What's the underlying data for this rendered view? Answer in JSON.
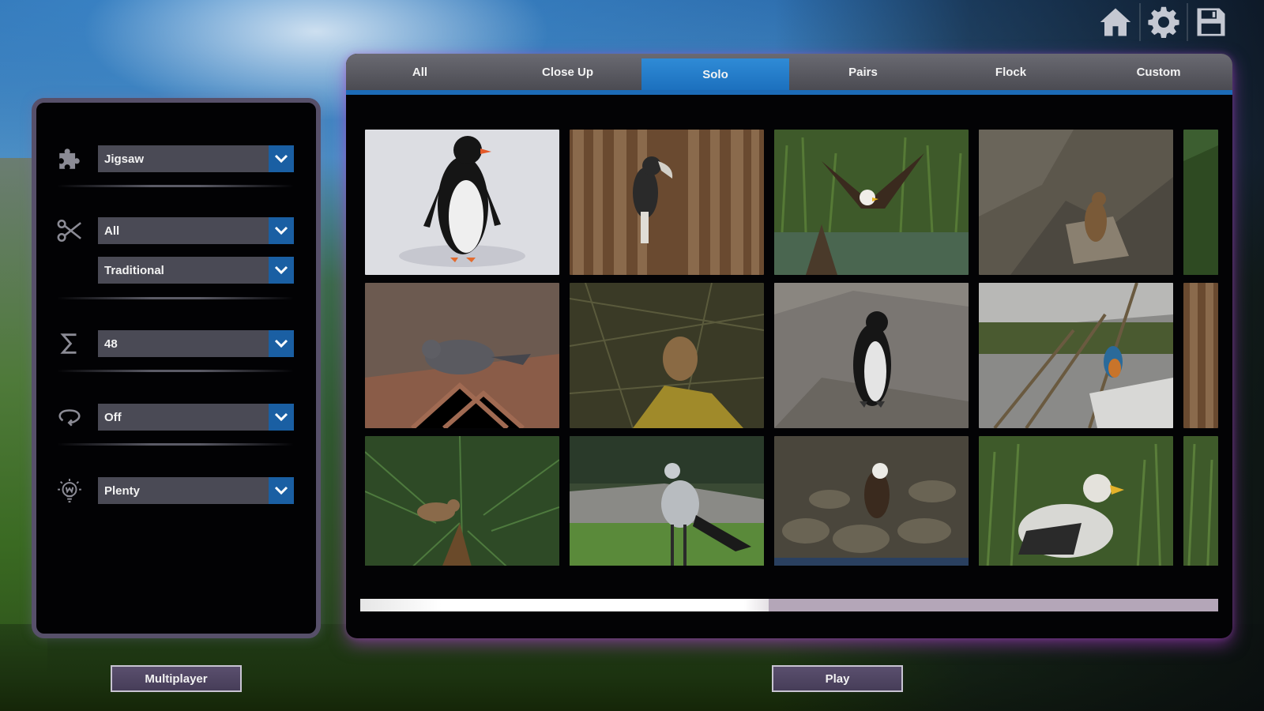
{
  "top_icons": [
    "home-icon",
    "gear-icon",
    "save-icon"
  ],
  "left_panel": {
    "rows": [
      {
        "icon": "puzzle-piece-icon",
        "value": "Jigsaw"
      },
      {
        "icon": "scissors-icon",
        "value": "All"
      },
      {
        "icon": null,
        "value": "Traditional"
      },
      {
        "icon": "sigma-icon",
        "value": "48"
      },
      {
        "icon": "rotate-icon",
        "value": "Off"
      },
      {
        "icon": "lightbulb-icon",
        "value": "Plenty"
      }
    ]
  },
  "tabs": [
    {
      "label": "All",
      "active": false
    },
    {
      "label": "Close Up",
      "active": false
    },
    {
      "label": "Solo",
      "active": true
    },
    {
      "label": "Pairs",
      "active": false
    },
    {
      "label": "Flock",
      "active": false
    },
    {
      "label": "Custom",
      "active": false
    }
  ],
  "puzzles": [
    {
      "subject": "penguin-on-snow"
    },
    {
      "subject": "hornbill-on-wood"
    },
    {
      "subject": "eagle-in-grass"
    },
    {
      "subject": "hawk-on-rock"
    },
    {
      "subject": "pigeon-on-rock"
    },
    {
      "subject": "owl-in-branches"
    },
    {
      "subject": "penguin-on-rock"
    },
    {
      "subject": "kingfisher-in-snow"
    },
    {
      "subject": "wren-in-pine"
    },
    {
      "subject": "secretary-bird-on-grass"
    },
    {
      "subject": "eagle-on-rocks"
    },
    {
      "subject": "vulture-in-grass"
    }
  ],
  "scroll": {
    "position_fraction": 0.476
  },
  "buttons": {
    "multiplayer": "Multiplayer",
    "play": "Play"
  },
  "colors": {
    "accent": "#1c6bb7",
    "tab_active": "#2f8bd6",
    "dropdown_bg": "#4a4a55",
    "button_bg": "#4f4563",
    "panel_border": "#57506a"
  }
}
